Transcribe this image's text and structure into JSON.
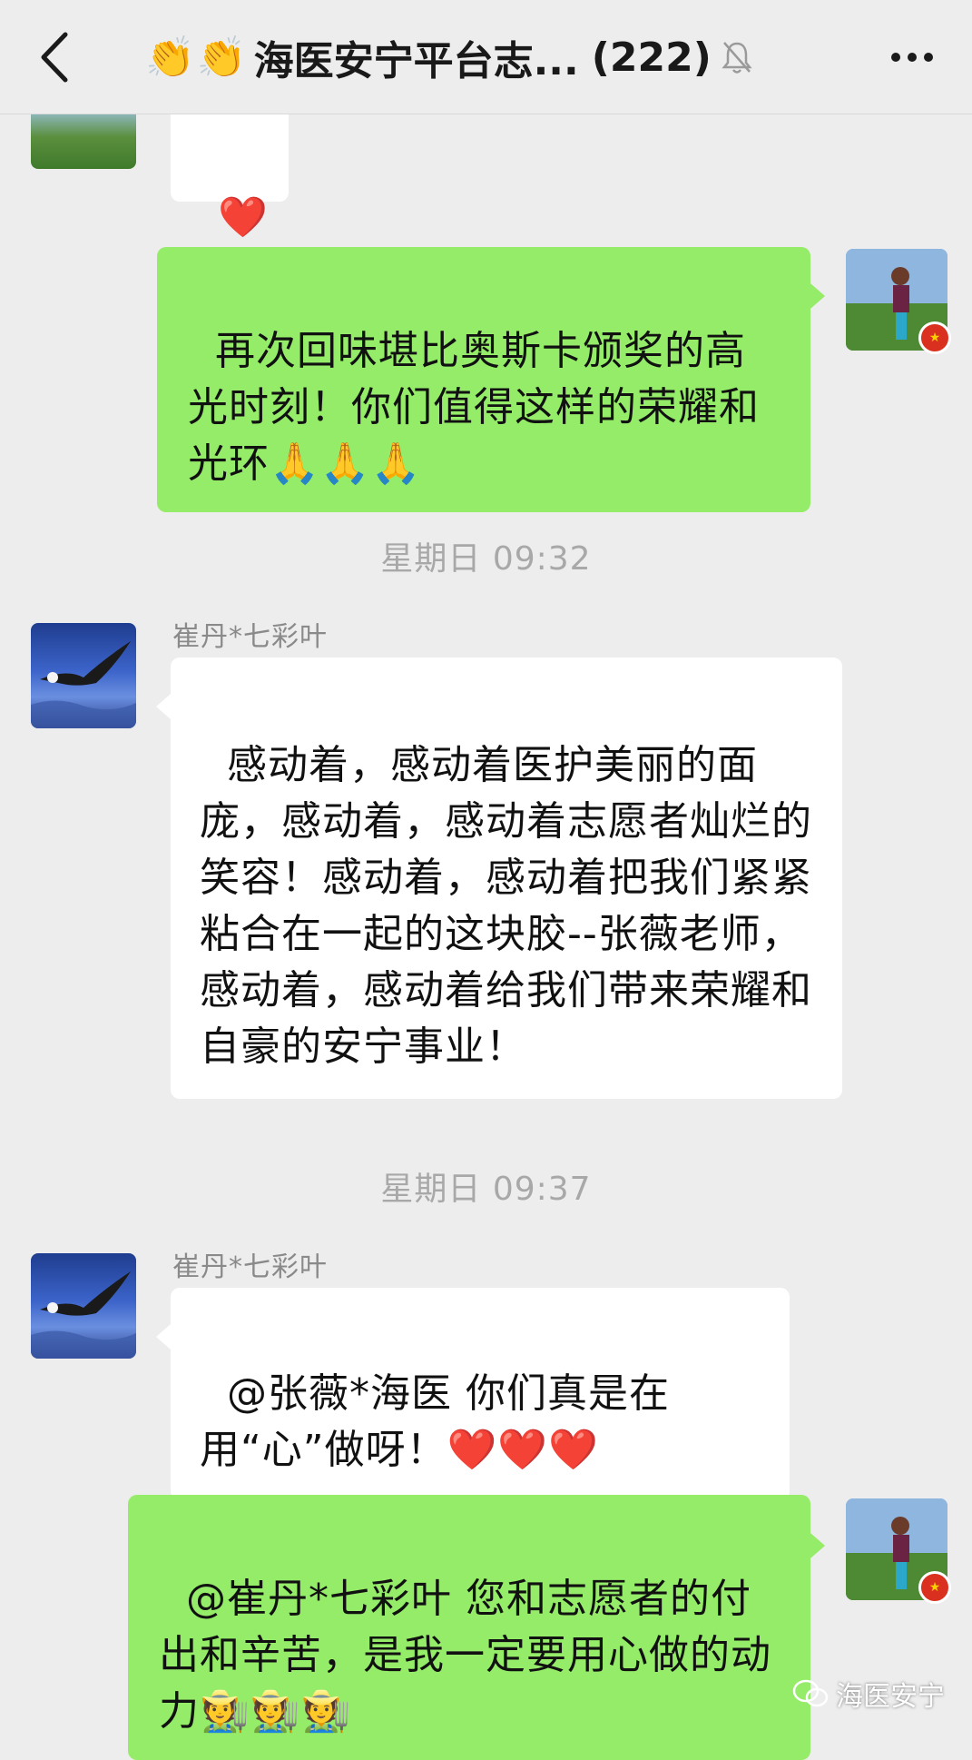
{
  "header": {
    "back_icon": "chevron-left-icon",
    "clap_icons": [
      "👏",
      "👏"
    ],
    "title": "海医安宁平台志...",
    "member_count": "(222)",
    "mute_icon": "bell-muted-icon",
    "more_icon": "more-horizontal-icon"
  },
  "messages": [
    {
      "side": "left",
      "text": "❤️"
    },
    {
      "side": "right",
      "text": "再次回味堪比奥斯卡颁奖的高光时刻！你们值得这样的荣耀和光环🙏🙏🙏"
    },
    {
      "timestamp": "星期日 09:32"
    },
    {
      "side": "left",
      "sender": "崔丹*七彩叶",
      "text": "感动着，感动着医护美丽的面庞，感动着，感动着志愿者灿烂的笑容！感动着，感动着把我们紧紧粘合在一起的这块胶--张薇老师，感动着，感动着给我们带来荣耀和自豪的安宁事业！"
    },
    {
      "timestamp": "星期日 09:37"
    },
    {
      "side": "left",
      "sender": "崔丹*七彩叶",
      "text": "@张薇*海医 你们真是在用“心”做呀！❤️❤️❤️"
    },
    {
      "side": "right",
      "text": "@崔丹*七彩叶 您和志愿者的付出和辛苦，是我一定要用心做的动力🧑‍🌾🧑‍🌾🧑‍🌾"
    }
  ],
  "watermark": "海医安宁",
  "colors": {
    "background": "#ededed",
    "bubble_self": "#95ec69",
    "bubble_other": "#ffffff",
    "timestamp": "#a8a8a8"
  }
}
